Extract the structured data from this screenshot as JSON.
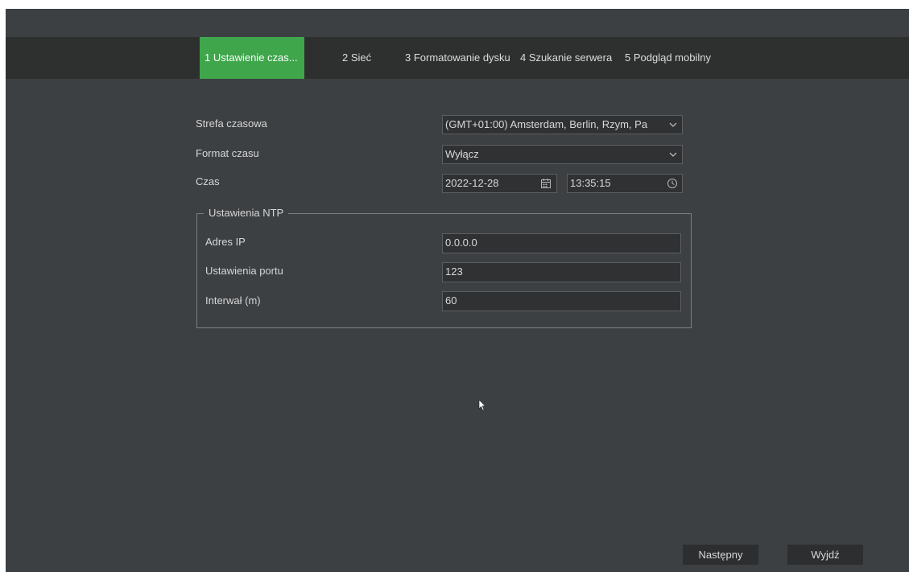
{
  "tabs": [
    {
      "label": "1 Ustawienie czas...",
      "active": true
    },
    {
      "label": "2 Sieć",
      "active": false
    },
    {
      "label": "3 Formatowanie dysku",
      "active": false
    },
    {
      "label": "4 Szukanie serwera",
      "active": false
    },
    {
      "label": "5 Podgląd mobilny",
      "active": false
    }
  ],
  "time_settings": {
    "timezone_label": "Strefa czasowa",
    "timezone_value": "(GMT+01:00) Amsterdam, Berlin, Rzym, Pa",
    "time_format_label": "Format czasu",
    "time_format_value": "Wyłącz",
    "time_label": "Czas",
    "date_value": "2022-12-28",
    "time_value": "13:35:15"
  },
  "ntp": {
    "legend": "Ustawienia NTP",
    "ip_label": "Adres IP",
    "ip_value": "0.0.0.0",
    "port_label": "Ustawienia portu",
    "port_value": "123",
    "interval_label": "Interwał (m)",
    "interval_value": "60"
  },
  "footer": {
    "next_label": "Następny",
    "exit_label": "Wyjdź"
  },
  "icons": {
    "dropdown": "chevron-down-icon",
    "date": "calendar-icon",
    "time": "clock-icon",
    "pointer": "mouse-cursor-icon"
  },
  "colors": {
    "background": "#3d4043",
    "tab_bar": "#2e302f",
    "active_tab": "#3fa64b",
    "field_bg": "#2f3133",
    "button_bg": "#2c2e30"
  }
}
